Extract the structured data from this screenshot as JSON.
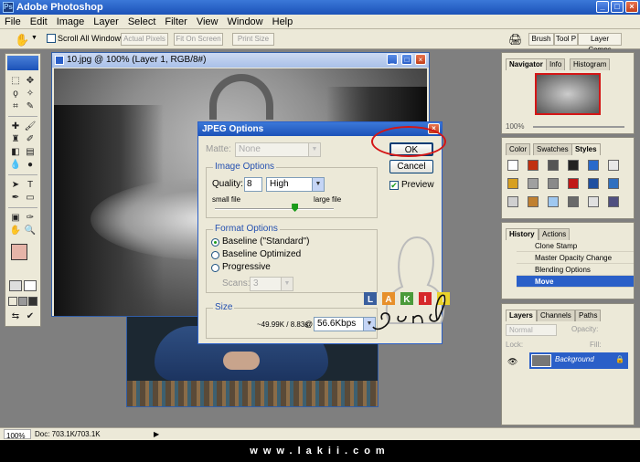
{
  "app": {
    "title": "Adobe Photoshop",
    "icon": "ps-icon"
  },
  "menu": [
    "File",
    "Edit",
    "Image",
    "Layer",
    "Select",
    "Filter",
    "View",
    "Window",
    "Help"
  ],
  "options_bar": {
    "scroll_all": "Scroll All Windows",
    "actual_pixels": "Actual Pixels",
    "fit_on_screen": "Fit On Screen",
    "print_size": "Print Size",
    "palette_tabs": [
      "Brush",
      "Tool P",
      "Layer Comps"
    ]
  },
  "document": {
    "title": "10.jpg @ 100% (Layer 1, RGB/8#)"
  },
  "dialog": {
    "title": "JPEG Options",
    "matte_label": "Matte:",
    "matte_value": "None",
    "image_options": "Image Options",
    "quality_label": "Quality:",
    "quality_value": "8",
    "quality_level": "High",
    "small_file": "small file",
    "large_file": "large file",
    "quality_slider_fraction": 0.67,
    "format_options": "Format Options",
    "baseline_standard": "Baseline (\"Standard\")",
    "baseline_optimized": "Baseline Optimized",
    "progressive": "Progressive",
    "scans_label": "Scans:",
    "scans_value": "3",
    "size": "Size",
    "size_value": "~49.99K / 8.83s",
    "at": "@",
    "speed": "56.6Kbps",
    "ok": "OK",
    "cancel": "Cancel",
    "preview": "Preview"
  },
  "navigator": {
    "tabs": [
      "Navigator",
      "Info",
      "Histogram"
    ],
    "zoom": "100%"
  },
  "styles": {
    "tabs": [
      "Color",
      "Swatches",
      "Styles"
    ],
    "colors": [
      "#ffffff",
      "#c03010",
      "#555555",
      "#222222",
      "#2a6acb",
      "#e8e8e8",
      "#d7a020",
      "#a0a0a0",
      "#8a8a8a",
      "#c01818",
      "#2050a0",
      "#3070c0",
      "#d0d0d0",
      "#c08030",
      "#9fc8f0",
      "#6a6a6a",
      "#e0e0e0",
      "#505080"
    ]
  },
  "history": {
    "tabs": [
      "History",
      "Actions"
    ],
    "items": [
      "Clone Stamp",
      "Master Opacity Change",
      "Blending Options",
      "Move"
    ]
  },
  "layers": {
    "tabs": [
      "Layers",
      "Channels",
      "Paths"
    ],
    "blend_mode": "Normal",
    "opacity_label": "Opacity:",
    "lock_label": "Lock:",
    "fill_label": "Fill:",
    "layer_name": "Background"
  },
  "status": {
    "zoom": "100%",
    "doc": "Doc: 703.1K/703.1K"
  },
  "footer": "www.lakii.com",
  "logo": {
    "letters": [
      "L",
      "A",
      "K",
      "I",
      "I"
    ]
  }
}
